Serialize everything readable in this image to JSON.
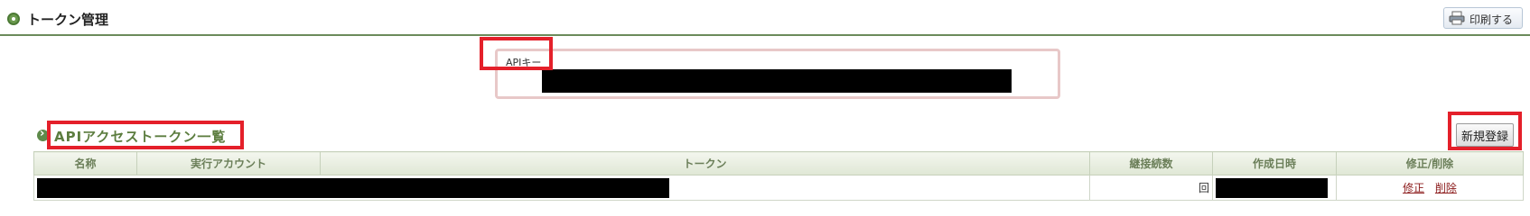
{
  "header": {
    "title": "トークン管理",
    "print_label": "印刷する"
  },
  "api_key": {
    "label": "APIキー",
    "value": ""
  },
  "section": {
    "title": "APIアクセストークン一覧",
    "new_button": "新規登録"
  },
  "table": {
    "columns": [
      "名称",
      "実行アカウント",
      "トークン",
      "継接続数",
      "作成日時",
      "修正/削除"
    ],
    "rows": [
      {
        "name": "",
        "account": "",
        "token": "",
        "count": "回",
        "created": "",
        "edit_label": "修正",
        "delete_label": "削除"
      }
    ]
  },
  "colors": {
    "accent_green": "#5c7d3f",
    "highlight_red": "#e4202a",
    "link_red": "#8b1a1a"
  },
  "icons": [
    "circle-bullet-icon",
    "printer-icon",
    "arrow-bullet-icon"
  ]
}
